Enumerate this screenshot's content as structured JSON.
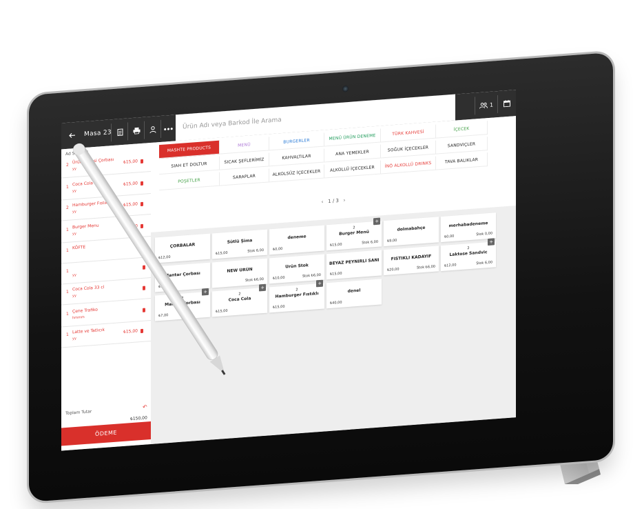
{
  "colors": {
    "accent": "#d9302b",
    "topbar": "#2f2f2f",
    "screen_bg": "#f2f2f2"
  },
  "topbar": {
    "back_icon": "arrow-left-icon",
    "table_title": "Masa 23",
    "print_bill_icon": "receipt-icon",
    "print_icon": "printer-icon",
    "waiter_icon": "person-icon",
    "more_label": "● ● ●",
    "search_placeholder": "Ürün Adı veya Barkod İle Arama",
    "guests_label": "1",
    "guests_icon": "people-icon",
    "calendar_icon": "calendar-icon"
  },
  "order": {
    "waiter": "Ad Soyad 1",
    "items": [
      {
        "qty": "2",
        "name": "Ürünçevresi Çorbası",
        "note": "yy",
        "price": "₺15,00"
      },
      {
        "qty": "1",
        "name": "Coca Cola",
        "note": "yy",
        "price": "₺15,00"
      },
      {
        "qty": "2",
        "name": "Hamburger Fıstıklı",
        "note": "yy",
        "price": "₺15,00"
      },
      {
        "qty": "1",
        "name": "Burger Menu",
        "note": "yy",
        "price": "₺15,00"
      },
      {
        "qty": "1",
        "name": "KÖFTE",
        "note": "",
        "price": ""
      },
      {
        "qty": "1",
        "name": "",
        "note": "yy",
        "price": ""
      },
      {
        "qty": "1",
        "name": "Coca Cola 33 cl",
        "note": "yy",
        "price": ""
      },
      {
        "qty": "1",
        "name": "Çene Trafiko",
        "note": "hmmm",
        "price": ""
      },
      {
        "qty": "1",
        "name": "Latte ve Tatlıcık",
        "note": "yy",
        "price": "₺15,00"
      }
    ],
    "total_label": "Toplam Tutar",
    "total_value": "₺150,00",
    "pay_label": "ÖDEME"
  },
  "categories": {
    "items": [
      {
        "label": "MASHTE PRODUCTS",
        "color": "#ffffff",
        "active": true
      },
      {
        "label": "MENÜ",
        "color": "#b07cd8",
        "active": false
      },
      {
        "label": "BURGERLER",
        "color": "#2b7bd6",
        "active": false
      },
      {
        "label": "MENÜ ÜRÜN DENEME",
        "color": "#1e9b5a",
        "active": false
      },
      {
        "label": "TÜRK KAHVESİ",
        "color": "#e53935",
        "active": false
      },
      {
        "label": "İÇECEK",
        "color": "#43a047",
        "active": false
      },
      {
        "label": "SIAH ET DOLTUR",
        "color": "#222222",
        "active": false
      },
      {
        "label": "SICAK ŞEFLERİMİZ",
        "color": "#222222",
        "active": false
      },
      {
        "label": "KAHVALTILAR",
        "color": "#222222",
        "active": false
      },
      {
        "label": "ANA YEMEKLER",
        "color": "#222222",
        "active": false
      },
      {
        "label": "SOĞUK İÇECEKLER",
        "color": "#222222",
        "active": false
      },
      {
        "label": "SANDVIÇLER",
        "color": "#222222",
        "active": false
      },
      {
        "label": "POŞETLER",
        "color": "#43a047",
        "active": false
      },
      {
        "label": "SARAPLAR",
        "color": "#222222",
        "active": false
      },
      {
        "label": "ALKOLSÜZ İÇECEKLER",
        "color": "#222222",
        "active": false
      },
      {
        "label": "ALKOLLÜ İÇECEKLER",
        "color": "#222222",
        "active": false
      },
      {
        "label": "İNÖ ALKOLLÜ DRINKS",
        "color": "#e53935",
        "active": false
      },
      {
        "label": "TAVA BALIKLAR",
        "color": "#222222",
        "active": false
      }
    ],
    "pager": "1 / 3",
    "prev_icon": "chevron-left-icon",
    "next_icon": "chevron-right-icon"
  },
  "products": [
    {
      "name": "ÇORBALAR",
      "qty": "",
      "price": "₺12,00",
      "other": "",
      "badge": ""
    },
    {
      "name": "Sütlü Şima",
      "qty": "",
      "price": "₺15,00",
      "other": "Stok 6,00",
      "badge": ""
    },
    {
      "name": "deneme",
      "qty": "",
      "price": "₺0,00",
      "other": "",
      "badge": ""
    },
    {
      "name": "Burger Menü",
      "qty": "2",
      "price": "₺15,00",
      "other": "Stok 6,00",
      "badge": "+"
    },
    {
      "name": "dolmabahçe",
      "qty": "",
      "price": "₺9,00",
      "other": "",
      "badge": ""
    },
    {
      "name": "merhabadeneme",
      "qty": "",
      "price": "₺0,00",
      "other": "Stok 0,00",
      "badge": ""
    },
    {
      "name": "Mantar Çorbası",
      "qty": "",
      "price": "₺7,00",
      "other": "",
      "badge": ""
    },
    {
      "name": "NEW ÜRÜN",
      "qty": "",
      "price": "",
      "other": "Stok ₺6,00",
      "badge": ""
    },
    {
      "name": "Ürün Stok",
      "qty": "",
      "price": "₺10,00",
      "other": "Stok ₺6,00",
      "badge": ""
    },
    {
      "name": "BEYAZ PEYNİRLİ SANDVIÇ",
      "qty": "",
      "price": "₺15,00",
      "other": "",
      "badge": ""
    },
    {
      "name": "FISTIKLI KADAYIF",
      "qty": "",
      "price": "₺20,00",
      "other": "Stok ₺6,00",
      "badge": ""
    },
    {
      "name": "Laktose Sandvic",
      "qty": "2",
      "price": "₺12,00",
      "other": "Stok 6,00",
      "badge": "+"
    },
    {
      "name": "Mantar Çorbası",
      "qty": "2",
      "price": "₺7,00",
      "other": "",
      "badge": "+"
    },
    {
      "name": "Coca Cola",
      "qty": "2",
      "price": "₺15,00",
      "other": "",
      "badge": "+"
    },
    {
      "name": "Hamburger Fıstıklı",
      "qty": "2",
      "price": "₺15,00",
      "other": "",
      "badge": "+"
    },
    {
      "name": "denel",
      "qty": "",
      "price": "₺40,00",
      "other": "",
      "badge": ""
    }
  ]
}
